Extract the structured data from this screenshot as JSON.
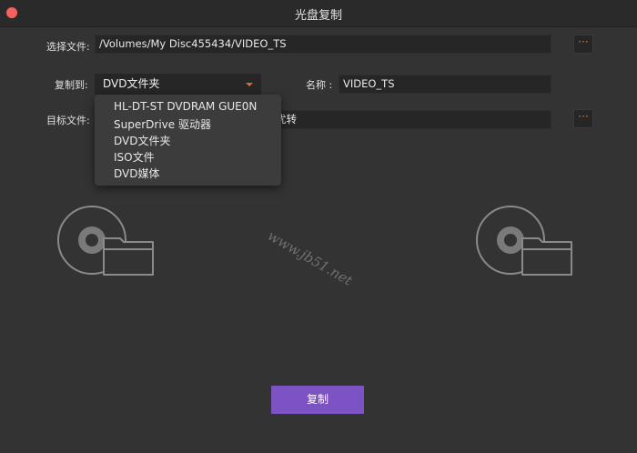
{
  "window": {
    "title": "光盘复制"
  },
  "source": {
    "label": "选择文件:",
    "value": "/Volumes/My Disc455434/VIDEO_TS",
    "browse_icon": "···"
  },
  "copy_to": {
    "label": "复制到:",
    "selected": "DVD文件夹",
    "options": [
      "HL-DT-ST DVDRAM GUE0N",
      "SuperDrive 驱动器",
      "DVD文件夹",
      "ISO文件",
      "DVD媒体"
    ]
  },
  "name": {
    "label": "名称 :",
    "value": "VIDEO_TS"
  },
  "target": {
    "label": "目标文件:",
    "value_visible": "优转",
    "browse_icon": "···"
  },
  "copy_button": {
    "label": "复制"
  },
  "watermark": "www.jb51.net",
  "colors": {
    "accent": "#e56a2e",
    "button": "#7d52c2",
    "close": "#fc605c"
  },
  "icons": {
    "source_icon": "disc-folder-icon",
    "target_icon": "disc-folder-icon"
  }
}
